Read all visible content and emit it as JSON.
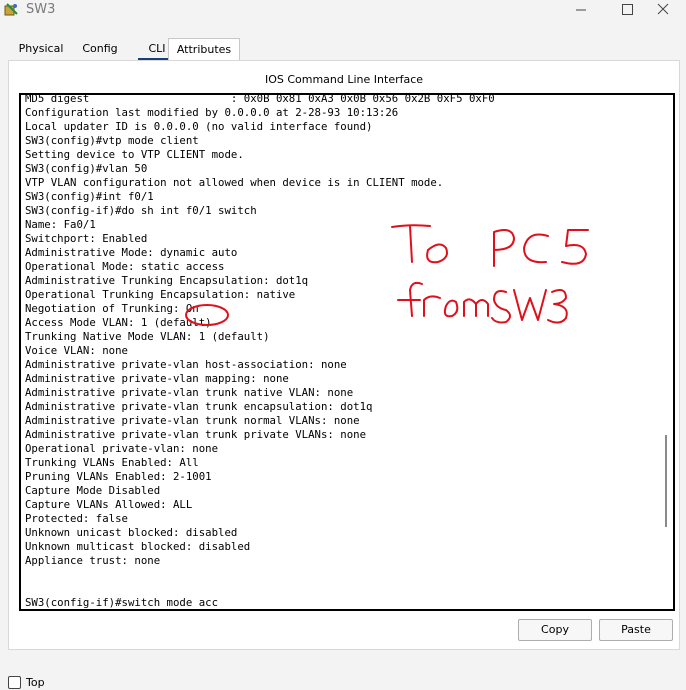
{
  "window": {
    "title": "SW3",
    "minimize_glyph": "—",
    "maximize_glyph": "☐",
    "close_glyph": "✕"
  },
  "tabs": [
    {
      "label": "Physical",
      "active": false
    },
    {
      "label": "Config",
      "active": false
    },
    {
      "label": "CLI",
      "active": true
    },
    {
      "label": "Attributes",
      "active": false
    }
  ],
  "panel": {
    "title": "IOS Command Line Interface"
  },
  "console": {
    "lines": [
      "MD5 digest                      : 0x0B 0x81 0xA3 0x0B 0x56 0x2B 0xF5 0xF0",
      "Configuration last modified by 0.0.0.0 at 2-28-93 10:13:26",
      "Local updater ID is 0.0.0.0 (no valid interface found)",
      "SW3(config)#vtp mode client",
      "Setting device to VTP CLIENT mode.",
      "SW3(config)#vlan 50",
      "VTP VLAN configuration not allowed when device is in CLIENT mode.",
      "SW3(config)#int f0/1",
      "SW3(config-if)#do sh int f0/1 switch",
      "Name: Fa0/1",
      "Switchport: Enabled",
      "Administrative Mode: dynamic auto",
      "Operational Mode: static access",
      "Administrative Trunking Encapsulation: dot1q",
      "Operational Trunking Encapsulation: native",
      "Negotiation of Trunking: On",
      "Access Mode VLAN: 1 (default)",
      "Trunking Native Mode VLAN: 1 (default)",
      "Voice VLAN: none",
      "Administrative private-vlan host-association: none",
      "Administrative private-vlan mapping: none",
      "Administrative private-vlan trunk native VLAN: none",
      "Administrative private-vlan trunk encapsulation: dot1q",
      "Administrative private-vlan trunk normal VLANs: none",
      "Administrative private-vlan trunk private VLANs: none",
      "Operational private-vlan: none",
      "Trunking VLANs Enabled: All",
      "Pruning VLANs Enabled: 2-1001",
      "Capture Mode Disabled",
      "Capture VLANs Allowed: ALL",
      "Protected: false",
      "Unknown unicast blocked: disabled",
      "Unknown multicast blocked: disabled",
      "Appliance trust: none",
      "",
      "",
      "SW3(config-if)#switch mode acc"
    ]
  },
  "buttons": {
    "copy": "Copy",
    "paste": "Paste"
  },
  "checkbox": {
    "label": "Top",
    "checked": false
  },
  "annotation": {
    "line1": "To PC5",
    "line2": "from SW3",
    "color": "#e0101a"
  }
}
